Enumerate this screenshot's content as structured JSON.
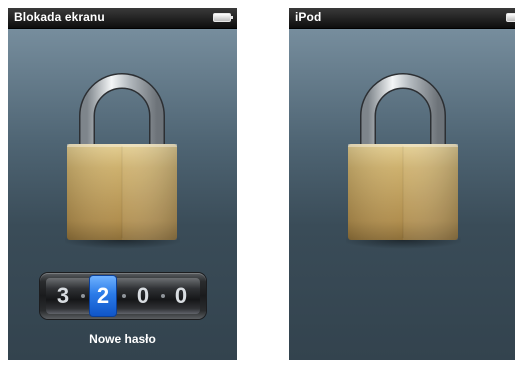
{
  "screens": {
    "left": {
      "status_title": "Blokada ekranu",
      "passcode_digits": [
        "3",
        "2",
        "0",
        "0"
      ],
      "active_digit_index": 1,
      "passcode_label": "Nowe hasło"
    },
    "right": {
      "status_title": "iPod"
    }
  },
  "colors": {
    "status_bar": "#111111",
    "screen_top": "#7e95a5",
    "screen_bottom": "#33434e",
    "active_digit": "#2b7be8",
    "lock_body": "#c9aa67"
  },
  "icons": {
    "battery": "battery-icon",
    "lock": "padlock-icon"
  }
}
